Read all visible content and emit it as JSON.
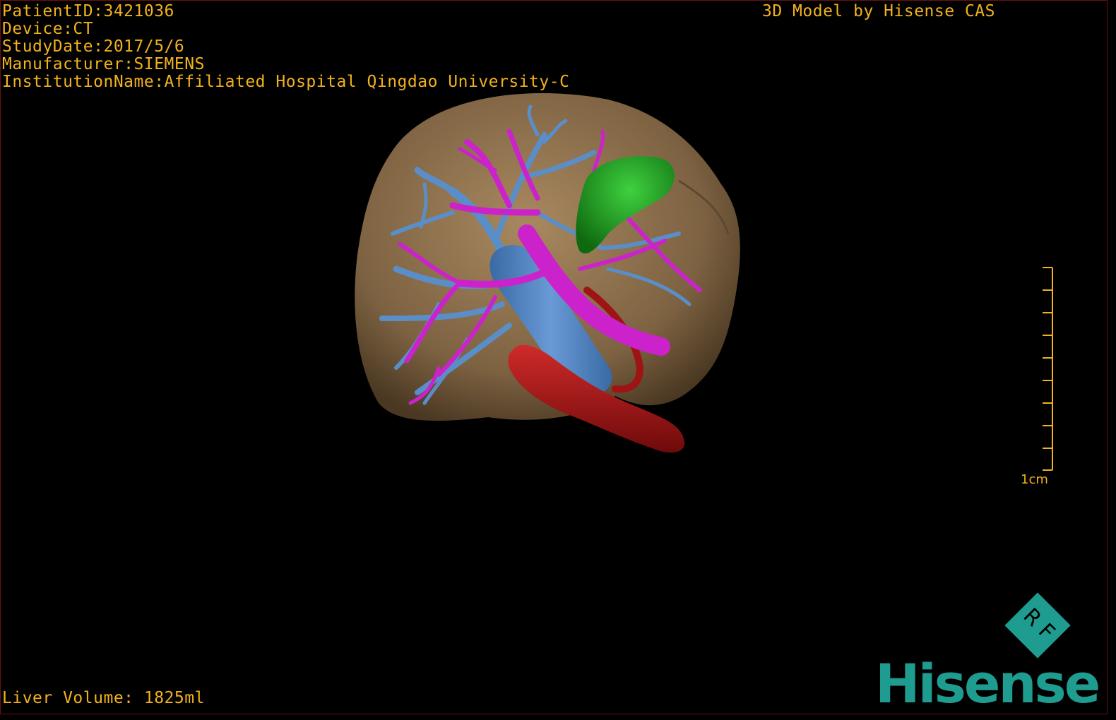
{
  "dicom_info": {
    "patient_id": "PatientID:3421036",
    "device": "Device:CT",
    "study_date": "StudyDate:2017/5/6",
    "manufacturer": "Manufacturer:SIEMENS",
    "institution": "InstitutionName:Affiliated Hospital Qingdao University-C"
  },
  "credit": "3D Model by Hisense CAS",
  "liver_volume": "Liver Volume: 1825ml",
  "scale_label": "1cm",
  "logo": {
    "mark_text": "R F",
    "brand": "Hisense",
    "brand_color": "#1e9c8f"
  },
  "colors": {
    "text": "#f2b21c",
    "liver": "#8a6e4a",
    "portal_vein": "#cc22cc",
    "hepatic_vein": "#5a8ec8",
    "ivc": "#4f7fb8",
    "artery": "#a31414",
    "gallbladder": "#1f9c1f"
  },
  "model_structures": [
    "liver",
    "hepatic-vein",
    "portal-vein",
    "inferior-vena-cava",
    "artery",
    "gallbladder"
  ]
}
